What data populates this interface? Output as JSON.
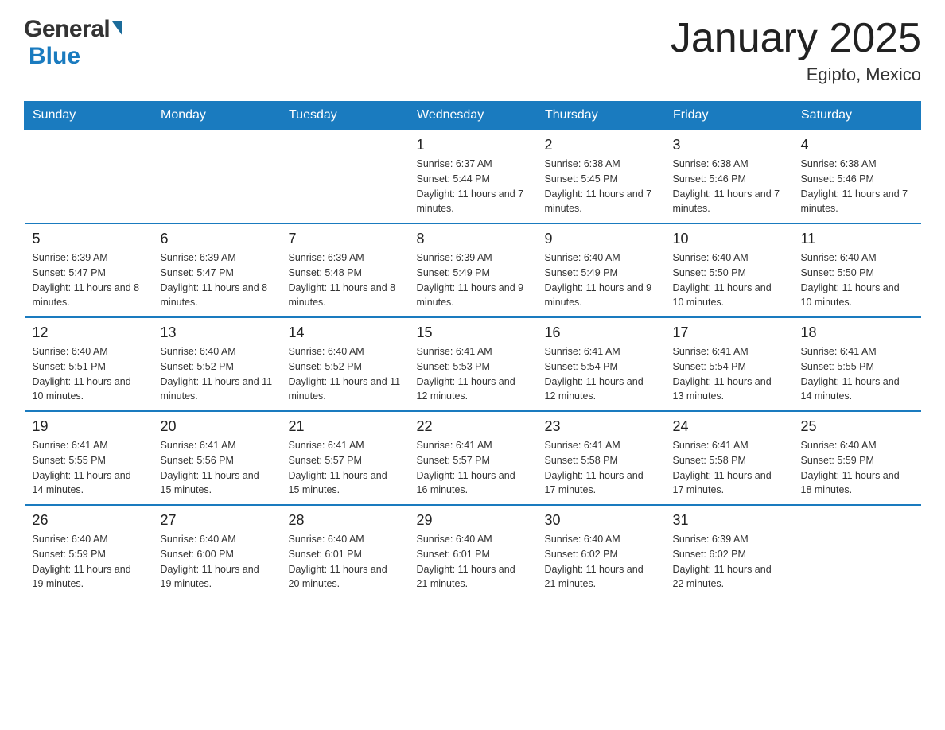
{
  "header": {
    "title": "January 2025",
    "subtitle": "Egipto, Mexico",
    "logo_general": "General",
    "logo_blue": "Blue"
  },
  "days_of_week": [
    "Sunday",
    "Monday",
    "Tuesday",
    "Wednesday",
    "Thursday",
    "Friday",
    "Saturday"
  ],
  "weeks": [
    [
      {
        "num": "",
        "info": ""
      },
      {
        "num": "",
        "info": ""
      },
      {
        "num": "",
        "info": ""
      },
      {
        "num": "1",
        "info": "Sunrise: 6:37 AM\nSunset: 5:44 PM\nDaylight: 11 hours and 7 minutes."
      },
      {
        "num": "2",
        "info": "Sunrise: 6:38 AM\nSunset: 5:45 PM\nDaylight: 11 hours and 7 minutes."
      },
      {
        "num": "3",
        "info": "Sunrise: 6:38 AM\nSunset: 5:46 PM\nDaylight: 11 hours and 7 minutes."
      },
      {
        "num": "4",
        "info": "Sunrise: 6:38 AM\nSunset: 5:46 PM\nDaylight: 11 hours and 7 minutes."
      }
    ],
    [
      {
        "num": "5",
        "info": "Sunrise: 6:39 AM\nSunset: 5:47 PM\nDaylight: 11 hours and 8 minutes."
      },
      {
        "num": "6",
        "info": "Sunrise: 6:39 AM\nSunset: 5:47 PM\nDaylight: 11 hours and 8 minutes."
      },
      {
        "num": "7",
        "info": "Sunrise: 6:39 AM\nSunset: 5:48 PM\nDaylight: 11 hours and 8 minutes."
      },
      {
        "num": "8",
        "info": "Sunrise: 6:39 AM\nSunset: 5:49 PM\nDaylight: 11 hours and 9 minutes."
      },
      {
        "num": "9",
        "info": "Sunrise: 6:40 AM\nSunset: 5:49 PM\nDaylight: 11 hours and 9 minutes."
      },
      {
        "num": "10",
        "info": "Sunrise: 6:40 AM\nSunset: 5:50 PM\nDaylight: 11 hours and 10 minutes."
      },
      {
        "num": "11",
        "info": "Sunrise: 6:40 AM\nSunset: 5:50 PM\nDaylight: 11 hours and 10 minutes."
      }
    ],
    [
      {
        "num": "12",
        "info": "Sunrise: 6:40 AM\nSunset: 5:51 PM\nDaylight: 11 hours and 10 minutes."
      },
      {
        "num": "13",
        "info": "Sunrise: 6:40 AM\nSunset: 5:52 PM\nDaylight: 11 hours and 11 minutes."
      },
      {
        "num": "14",
        "info": "Sunrise: 6:40 AM\nSunset: 5:52 PM\nDaylight: 11 hours and 11 minutes."
      },
      {
        "num": "15",
        "info": "Sunrise: 6:41 AM\nSunset: 5:53 PM\nDaylight: 11 hours and 12 minutes."
      },
      {
        "num": "16",
        "info": "Sunrise: 6:41 AM\nSunset: 5:54 PM\nDaylight: 11 hours and 12 minutes."
      },
      {
        "num": "17",
        "info": "Sunrise: 6:41 AM\nSunset: 5:54 PM\nDaylight: 11 hours and 13 minutes."
      },
      {
        "num": "18",
        "info": "Sunrise: 6:41 AM\nSunset: 5:55 PM\nDaylight: 11 hours and 14 minutes."
      }
    ],
    [
      {
        "num": "19",
        "info": "Sunrise: 6:41 AM\nSunset: 5:55 PM\nDaylight: 11 hours and 14 minutes."
      },
      {
        "num": "20",
        "info": "Sunrise: 6:41 AM\nSunset: 5:56 PM\nDaylight: 11 hours and 15 minutes."
      },
      {
        "num": "21",
        "info": "Sunrise: 6:41 AM\nSunset: 5:57 PM\nDaylight: 11 hours and 15 minutes."
      },
      {
        "num": "22",
        "info": "Sunrise: 6:41 AM\nSunset: 5:57 PM\nDaylight: 11 hours and 16 minutes."
      },
      {
        "num": "23",
        "info": "Sunrise: 6:41 AM\nSunset: 5:58 PM\nDaylight: 11 hours and 17 minutes."
      },
      {
        "num": "24",
        "info": "Sunrise: 6:41 AM\nSunset: 5:58 PM\nDaylight: 11 hours and 17 minutes."
      },
      {
        "num": "25",
        "info": "Sunrise: 6:40 AM\nSunset: 5:59 PM\nDaylight: 11 hours and 18 minutes."
      }
    ],
    [
      {
        "num": "26",
        "info": "Sunrise: 6:40 AM\nSunset: 5:59 PM\nDaylight: 11 hours and 19 minutes."
      },
      {
        "num": "27",
        "info": "Sunrise: 6:40 AM\nSunset: 6:00 PM\nDaylight: 11 hours and 19 minutes."
      },
      {
        "num": "28",
        "info": "Sunrise: 6:40 AM\nSunset: 6:01 PM\nDaylight: 11 hours and 20 minutes."
      },
      {
        "num": "29",
        "info": "Sunrise: 6:40 AM\nSunset: 6:01 PM\nDaylight: 11 hours and 21 minutes."
      },
      {
        "num": "30",
        "info": "Sunrise: 6:40 AM\nSunset: 6:02 PM\nDaylight: 11 hours and 21 minutes."
      },
      {
        "num": "31",
        "info": "Sunrise: 6:39 AM\nSunset: 6:02 PM\nDaylight: 11 hours and 22 minutes."
      },
      {
        "num": "",
        "info": ""
      }
    ]
  ]
}
